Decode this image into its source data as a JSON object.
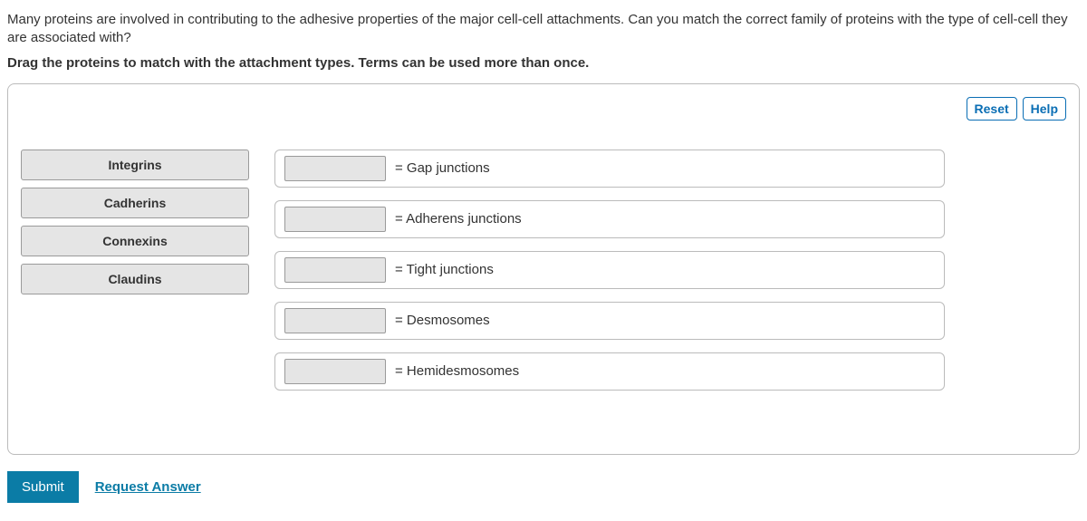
{
  "question": "Many proteins are involved in contributing to the adhesive properties of the major cell-cell attachments. Can you match the correct family of proteins with the type of cell-cell they are associated with?",
  "instructions": "Drag the proteins to match with the attachment types. Terms can be used more than once.",
  "buttons": {
    "reset": "Reset",
    "help": "Help",
    "submit": "Submit",
    "request_answer": "Request Answer"
  },
  "source_tiles": [
    "Integrins",
    "Cadherins",
    "Connexins",
    "Claudins"
  ],
  "targets": [
    {
      "label": "= Gap junctions"
    },
    {
      "label": "= Adherens junctions"
    },
    {
      "label": "= Tight junctions"
    },
    {
      "label": "= Desmosomes"
    },
    {
      "label": "= Hemidesmosomes"
    }
  ]
}
